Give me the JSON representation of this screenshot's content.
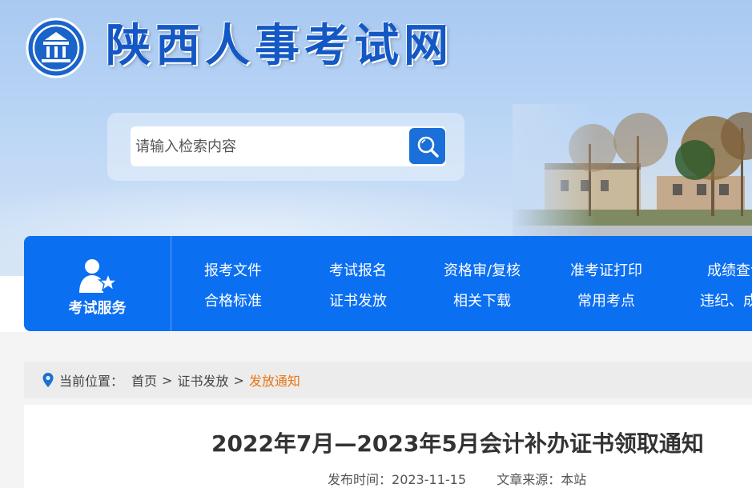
{
  "site": {
    "title": "陕西人事考试网"
  },
  "search": {
    "placeholder": "请输入检索内容"
  },
  "nav": {
    "service_label": "考试服务",
    "links_row1": [
      "报考文件",
      "考试报名",
      "资格审/复核",
      "准考证打印",
      "成绩查询"
    ],
    "links_row2": [
      "合格标准",
      "证书发放",
      "相关下载",
      "常用考点",
      "违纪、成绩"
    ]
  },
  "breadcrumb": {
    "prefix": "当前位置：",
    "items": [
      "首页",
      "证书发放"
    ],
    "current": "发放通知",
    "separator": ">"
  },
  "article": {
    "title": "2022年7月—2023年5月会计补办证书领取通知",
    "publish_label": "发布时间：",
    "publish_date": "2023-11-15",
    "source_label": "文章来源：",
    "source": "本站"
  },
  "colors": {
    "nav_blue": "#0b6ff2",
    "title_blue": "#1458c5",
    "current_orange": "#e87512"
  }
}
